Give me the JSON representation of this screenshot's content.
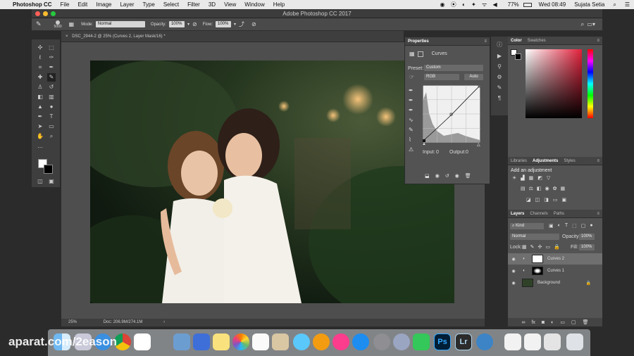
{
  "menubar": {
    "apple": "",
    "app_name": "Photoshop CC",
    "items": [
      "File",
      "Edit",
      "Image",
      "Layer",
      "Type",
      "Select",
      "Filter",
      "3D",
      "View",
      "Window",
      "Help"
    ],
    "battery": "77%",
    "clock": "Wed 08:49",
    "user": "Sujata Setia"
  },
  "window": {
    "title": "Adobe Photoshop CC 2017"
  },
  "options_bar": {
    "brush_size": "5000",
    "mode_label": "Mode:",
    "mode_value": "Normal",
    "opacity_label": "Opacity:",
    "opacity_value": "100%",
    "flow_label": "Flow:",
    "flow_value": "100%"
  },
  "document": {
    "tab_title": "DSC_2944-2 @ 25% (Curves 2, Layer Mask/16) *",
    "zoom": "25%",
    "doc_info": "Doc: 206.9M/274.1M"
  },
  "properties": {
    "title": "Properties",
    "adjustment": "Curves",
    "preset_label": "Preset:",
    "preset_value": "Custom",
    "channel": "RGB",
    "auto_label": "Auto",
    "input_label": "Input:",
    "input_value": "0",
    "output_label": "Output:",
    "output_value": "0"
  },
  "color_panel": {
    "tab_color": "Color",
    "tab_swatches": "Swatches"
  },
  "adjustments_panel": {
    "tab_libraries": "Libraries",
    "tab_adjustments": "Adjustments",
    "tab_styles": "Styles",
    "add_label": "Add an adjustment"
  },
  "layers_panel": {
    "tab_layers": "Layers",
    "tab_channels": "Channels",
    "tab_paths": "Paths",
    "filter_kind": "Kind",
    "blend_mode": "Normal",
    "opacity_label": "Opacity:",
    "opacity_value": "100%",
    "lock_label": "Lock:",
    "fill_label": "Fill:",
    "fill_value": "100%",
    "layers": [
      {
        "name": "Curves 2",
        "selected": true
      },
      {
        "name": "Curves 1",
        "selected": false
      },
      {
        "name": "Background",
        "selected": false
      }
    ]
  },
  "dock": {
    "ps_label": "Ps",
    "lr_label": "Lr"
  },
  "watermark": "aparat.com/2eason",
  "colors": {
    "accent_gradient_red": "#e2213b",
    "ps_blue": "#31a8ff",
    "lr_blue": "#add5ec"
  }
}
